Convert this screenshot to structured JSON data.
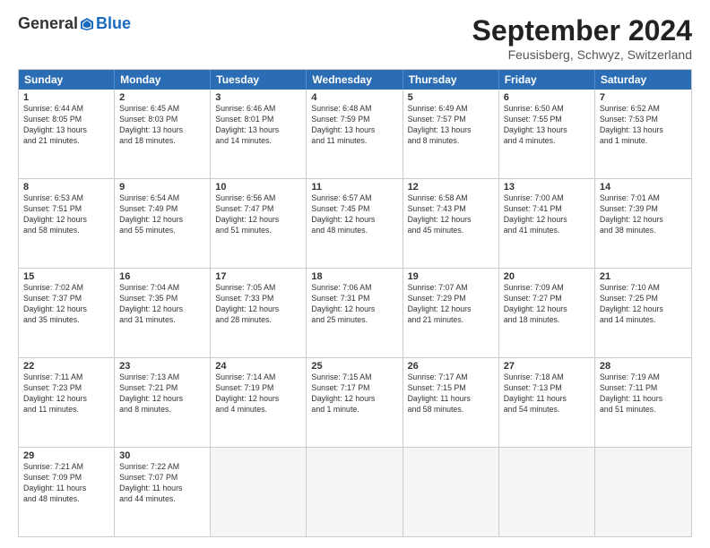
{
  "logo": {
    "general": "General",
    "blue": "Blue"
  },
  "title": "September 2024",
  "location": "Feusisberg, Schwyz, Switzerland",
  "headers": [
    "Sunday",
    "Monday",
    "Tuesday",
    "Wednesday",
    "Thursday",
    "Friday",
    "Saturday"
  ],
  "rows": [
    [
      {
        "day": "1",
        "info": "Sunrise: 6:44 AM\nSunset: 8:05 PM\nDaylight: 13 hours\nand 21 minutes."
      },
      {
        "day": "2",
        "info": "Sunrise: 6:45 AM\nSunset: 8:03 PM\nDaylight: 13 hours\nand 18 minutes."
      },
      {
        "day": "3",
        "info": "Sunrise: 6:46 AM\nSunset: 8:01 PM\nDaylight: 13 hours\nand 14 minutes."
      },
      {
        "day": "4",
        "info": "Sunrise: 6:48 AM\nSunset: 7:59 PM\nDaylight: 13 hours\nand 11 minutes."
      },
      {
        "day": "5",
        "info": "Sunrise: 6:49 AM\nSunset: 7:57 PM\nDaylight: 13 hours\nand 8 minutes."
      },
      {
        "day": "6",
        "info": "Sunrise: 6:50 AM\nSunset: 7:55 PM\nDaylight: 13 hours\nand 4 minutes."
      },
      {
        "day": "7",
        "info": "Sunrise: 6:52 AM\nSunset: 7:53 PM\nDaylight: 13 hours\nand 1 minute."
      }
    ],
    [
      {
        "day": "8",
        "info": "Sunrise: 6:53 AM\nSunset: 7:51 PM\nDaylight: 12 hours\nand 58 minutes."
      },
      {
        "day": "9",
        "info": "Sunrise: 6:54 AM\nSunset: 7:49 PM\nDaylight: 12 hours\nand 55 minutes."
      },
      {
        "day": "10",
        "info": "Sunrise: 6:56 AM\nSunset: 7:47 PM\nDaylight: 12 hours\nand 51 minutes."
      },
      {
        "day": "11",
        "info": "Sunrise: 6:57 AM\nSunset: 7:45 PM\nDaylight: 12 hours\nand 48 minutes."
      },
      {
        "day": "12",
        "info": "Sunrise: 6:58 AM\nSunset: 7:43 PM\nDaylight: 12 hours\nand 45 minutes."
      },
      {
        "day": "13",
        "info": "Sunrise: 7:00 AM\nSunset: 7:41 PM\nDaylight: 12 hours\nand 41 minutes."
      },
      {
        "day": "14",
        "info": "Sunrise: 7:01 AM\nSunset: 7:39 PM\nDaylight: 12 hours\nand 38 minutes."
      }
    ],
    [
      {
        "day": "15",
        "info": "Sunrise: 7:02 AM\nSunset: 7:37 PM\nDaylight: 12 hours\nand 35 minutes."
      },
      {
        "day": "16",
        "info": "Sunrise: 7:04 AM\nSunset: 7:35 PM\nDaylight: 12 hours\nand 31 minutes."
      },
      {
        "day": "17",
        "info": "Sunrise: 7:05 AM\nSunset: 7:33 PM\nDaylight: 12 hours\nand 28 minutes."
      },
      {
        "day": "18",
        "info": "Sunrise: 7:06 AM\nSunset: 7:31 PM\nDaylight: 12 hours\nand 25 minutes."
      },
      {
        "day": "19",
        "info": "Sunrise: 7:07 AM\nSunset: 7:29 PM\nDaylight: 12 hours\nand 21 minutes."
      },
      {
        "day": "20",
        "info": "Sunrise: 7:09 AM\nSunset: 7:27 PM\nDaylight: 12 hours\nand 18 minutes."
      },
      {
        "day": "21",
        "info": "Sunrise: 7:10 AM\nSunset: 7:25 PM\nDaylight: 12 hours\nand 14 minutes."
      }
    ],
    [
      {
        "day": "22",
        "info": "Sunrise: 7:11 AM\nSunset: 7:23 PM\nDaylight: 12 hours\nand 11 minutes."
      },
      {
        "day": "23",
        "info": "Sunrise: 7:13 AM\nSunset: 7:21 PM\nDaylight: 12 hours\nand 8 minutes."
      },
      {
        "day": "24",
        "info": "Sunrise: 7:14 AM\nSunset: 7:19 PM\nDaylight: 12 hours\nand 4 minutes."
      },
      {
        "day": "25",
        "info": "Sunrise: 7:15 AM\nSunset: 7:17 PM\nDaylight: 12 hours\nand 1 minute."
      },
      {
        "day": "26",
        "info": "Sunrise: 7:17 AM\nSunset: 7:15 PM\nDaylight: 11 hours\nand 58 minutes."
      },
      {
        "day": "27",
        "info": "Sunrise: 7:18 AM\nSunset: 7:13 PM\nDaylight: 11 hours\nand 54 minutes."
      },
      {
        "day": "28",
        "info": "Sunrise: 7:19 AM\nSunset: 7:11 PM\nDaylight: 11 hours\nand 51 minutes."
      }
    ],
    [
      {
        "day": "29",
        "info": "Sunrise: 7:21 AM\nSunset: 7:09 PM\nDaylight: 11 hours\nand 48 minutes."
      },
      {
        "day": "30",
        "info": "Sunrise: 7:22 AM\nSunset: 7:07 PM\nDaylight: 11 hours\nand 44 minutes."
      },
      {
        "day": "",
        "info": ""
      },
      {
        "day": "",
        "info": ""
      },
      {
        "day": "",
        "info": ""
      },
      {
        "day": "",
        "info": ""
      },
      {
        "day": "",
        "info": ""
      }
    ]
  ]
}
